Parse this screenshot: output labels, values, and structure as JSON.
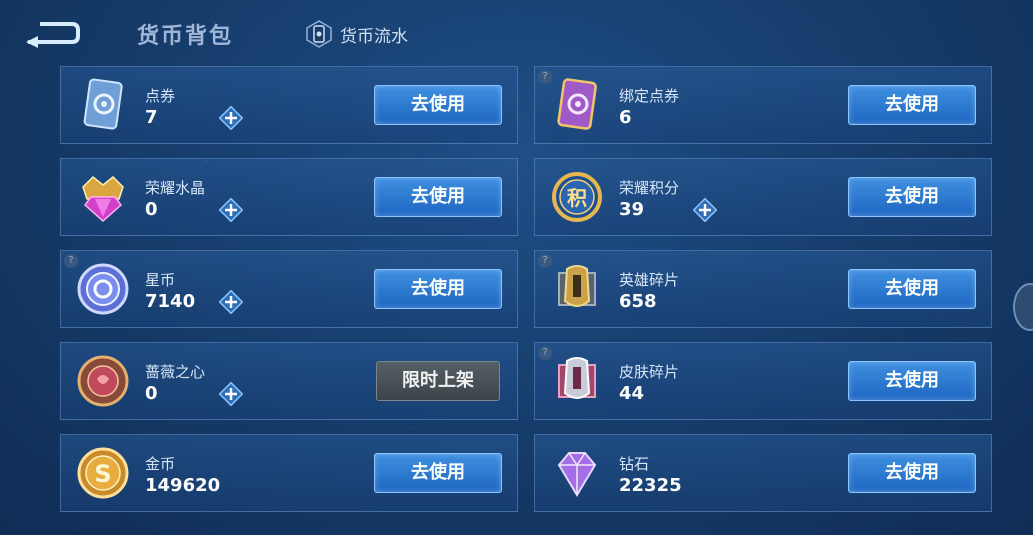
{
  "header": {
    "title": "货币背包",
    "flow_label": "货币流水"
  },
  "button_label": "去使用",
  "cards": [
    {
      "name": "点券",
      "value": "7",
      "icon": "coupon-card-icon"
    },
    {
      "name": "绑定点券",
      "value": "6",
      "icon": "bound-coupon-card-icon"
    },
    {
      "name": "荣耀水晶",
      "value": "0",
      "icon": "glory-crystal-icon"
    },
    {
      "name": "荣耀积分",
      "value": "39",
      "icon": "glory-points-icon"
    },
    {
      "name": "星币",
      "value": "7140",
      "icon": "star-coin-icon"
    },
    {
      "name": "英雄碎片",
      "value": "658",
      "icon": "hero-fragment-icon"
    },
    {
      "name": "蔷薇之心",
      "value": "0",
      "icon": "rose-heart-icon"
    },
    {
      "name": "皮肤碎片",
      "value": "44",
      "icon": "skin-fragment-icon"
    },
    {
      "name": "金币",
      "value": "149620",
      "icon": "gold-coin-icon"
    },
    {
      "name": "钻石",
      "value": "22325",
      "icon": "diamond-icon"
    }
  ],
  "limited_label": "限时上架"
}
